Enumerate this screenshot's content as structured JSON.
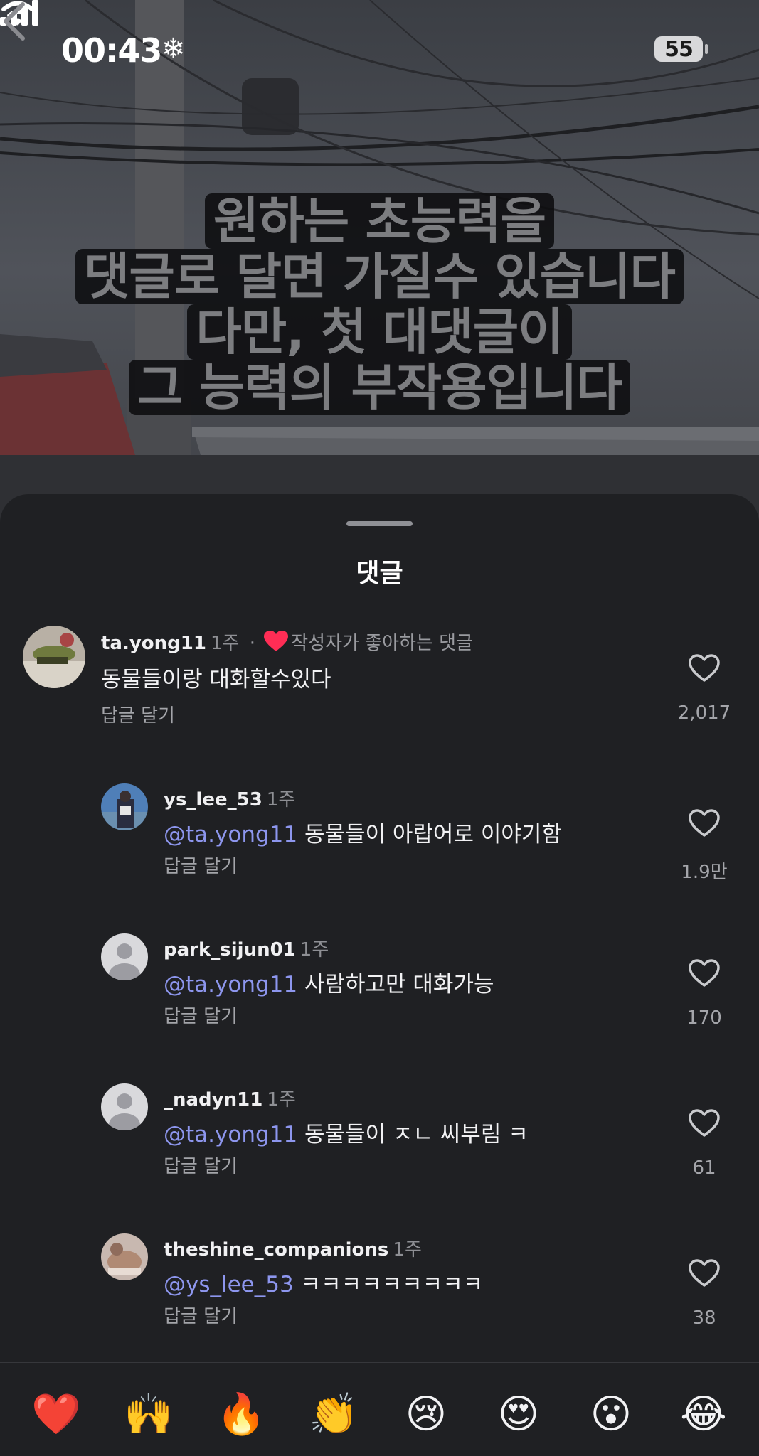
{
  "status_bar": {
    "time": "00:43",
    "battery": "55"
  },
  "video": {
    "overlay_lines": [
      "원하는 초능력을",
      "댓글로 달면 가질수 있습니다",
      "다만, 첫 대댓글이",
      "그 능력의 부작용입니다"
    ]
  },
  "sheet": {
    "title": "댓글"
  },
  "comments": [
    {
      "username": "ta.yong11",
      "time": "1주",
      "author_liked_label": "작성자가 좋아하는 댓글",
      "text": "동물들이랑 대화할수있다",
      "reply_label": "답글 달기",
      "likes": "2,017"
    },
    {
      "username": "ys_lee_53",
      "time": "1주",
      "mention": "@ta.yong11",
      "text": "동물들이 아랍어로 이야기함",
      "reply_label": "답글 달기",
      "likes": "1.9만"
    },
    {
      "username": "park_sijun01",
      "time": "1주",
      "mention": "@ta.yong11",
      "text": "사람하고만 대화가능",
      "reply_label": "답글 달기",
      "likes": "170"
    },
    {
      "username": "_nadyn11",
      "time": "1주",
      "mention": "@ta.yong11",
      "text": "동물들이 ㅈㄴ 씨부림 ㅋ",
      "reply_label": "답글 달기",
      "likes": "61"
    },
    {
      "username": "theshine_companions",
      "time": "1주",
      "mention": "@ys_lee_53",
      "text": "ㅋㅋㅋㅋㅋㅋㅋㅋㅋ",
      "reply_label": "답글 달기",
      "likes": "38"
    }
  ],
  "emoji_bar": [
    "❤️",
    "🙌",
    "🔥",
    "👏",
    "😢",
    "😍",
    "😮",
    "😂"
  ],
  "colors": {
    "mention": "#8d96ee",
    "liked_heart": "#ff2d55",
    "sheet_bg": "#1f2023"
  }
}
